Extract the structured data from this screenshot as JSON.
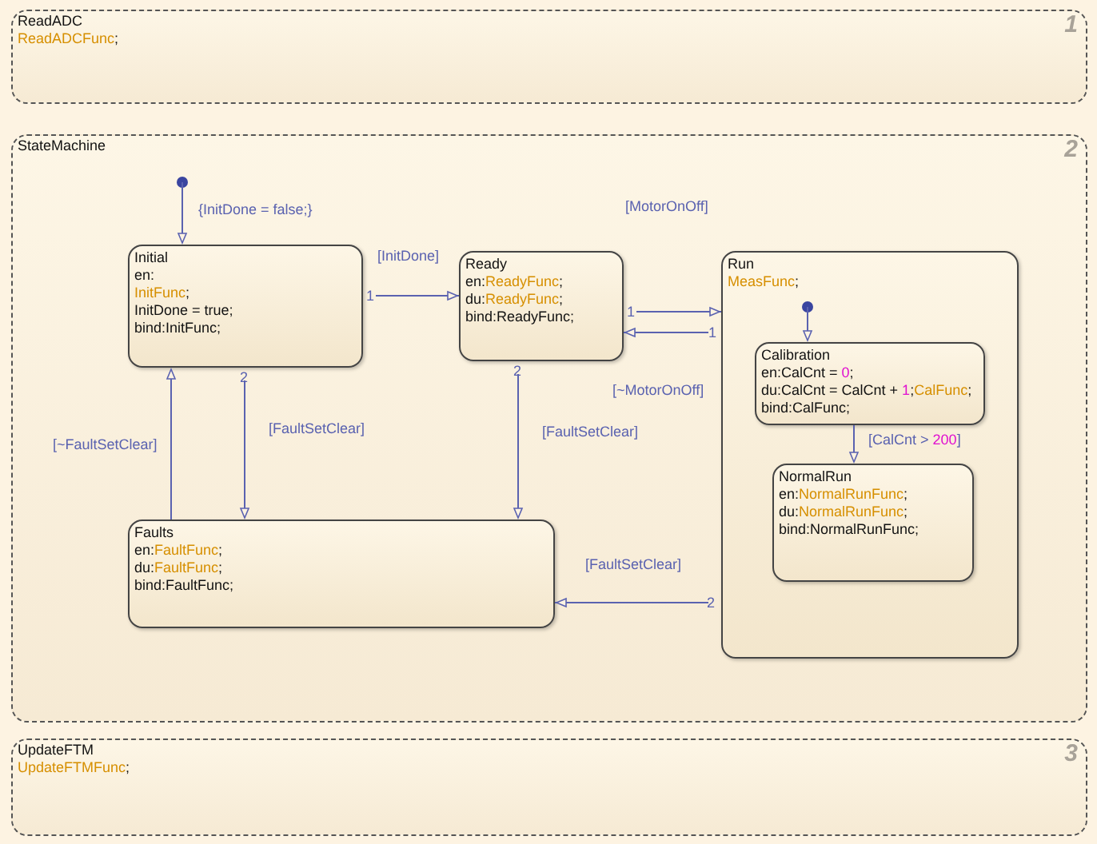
{
  "chart": {
    "parallel_states": [
      {
        "name": "ReadADC",
        "number": "1",
        "lines": [
          [
            {
              "kind": "function",
              "text": "ReadADCFunc"
            },
            {
              "kind": "text",
              "text": ";"
            }
          ]
        ]
      },
      {
        "name": "StateMachine",
        "number": "2",
        "states": [
          {
            "name": "Initial",
            "lines": [
              [
                {
                  "kind": "text",
                  "text": "en:"
                }
              ],
              [
                {
                  "kind": "function",
                  "text": "InitFunc"
                },
                {
                  "kind": "text",
                  "text": ";"
                }
              ],
              [
                {
                  "kind": "text",
                  "text": "InitDone = true;"
                }
              ],
              [
                {
                  "kind": "text",
                  "text": "bind:InitFunc;"
                }
              ]
            ]
          },
          {
            "name": "Ready",
            "lines": [
              [
                {
                  "kind": "text",
                  "text": "en:"
                },
                {
                  "kind": "function",
                  "text": "ReadyFunc"
                },
                {
                  "kind": "text",
                  "text": ";"
                }
              ],
              [
                {
                  "kind": "text",
                  "text": "du:"
                },
                {
                  "kind": "function",
                  "text": "ReadyFunc"
                },
                {
                  "kind": "text",
                  "text": ";"
                }
              ],
              [
                {
                  "kind": "text",
                  "text": "bind:ReadyFunc;"
                }
              ]
            ]
          },
          {
            "name": "Run",
            "lines": [
              [
                {
                  "kind": "function",
                  "text": "MeasFunc"
                },
                {
                  "kind": "text",
                  "text": ";"
                }
              ]
            ],
            "children": [
              {
                "name": "Calibration",
                "lines": [
                  [
                    {
                      "kind": "text",
                      "text": "en:CalCnt = "
                    },
                    {
                      "kind": "number",
                      "text": "0"
                    },
                    {
                      "kind": "text",
                      "text": ";"
                    }
                  ],
                  [
                    {
                      "kind": "text",
                      "text": "du:CalCnt = CalCnt + "
                    },
                    {
                      "kind": "number",
                      "text": "1"
                    },
                    {
                      "kind": "text",
                      "text": ";"
                    },
                    {
                      "kind": "function",
                      "text": "CalFunc"
                    },
                    {
                      "kind": "text",
                      "text": ";"
                    }
                  ],
                  [
                    {
                      "kind": "text",
                      "text": "bind:CalFunc;"
                    }
                  ]
                ]
              },
              {
                "name": "NormalRun",
                "lines": [
                  [
                    {
                      "kind": "text",
                      "text": "en:"
                    },
                    {
                      "kind": "function",
                      "text": "NormalRunFunc"
                    },
                    {
                      "kind": "text",
                      "text": ";"
                    }
                  ],
                  [
                    {
                      "kind": "text",
                      "text": "du:"
                    },
                    {
                      "kind": "function",
                      "text": "NormalRunFunc"
                    },
                    {
                      "kind": "text",
                      "text": ";"
                    }
                  ],
                  [
                    {
                      "kind": "text",
                      "text": "bind:NormalRunFunc;"
                    }
                  ]
                ]
              }
            ],
            "transitions": [
              {
                "kind": "default"
              },
              {
                "kind": "normal",
                "label": [
                  {
                    "kind": "text",
                    "text": "[CalCnt > "
                  },
                  {
                    "kind": "number",
                    "text": "200"
                  },
                  {
                    "kind": "text",
                    "text": "]"
                  }
                ]
              }
            ]
          },
          {
            "name": "Faults",
            "lines": [
              [
                {
                  "kind": "text",
                  "text": "en:"
                },
                {
                  "kind": "function",
                  "text": "FaultFunc"
                },
                {
                  "kind": "text",
                  "text": ";"
                }
              ],
              [
                {
                  "kind": "text",
                  "text": "du:"
                },
                {
                  "kind": "function",
                  "text": "FaultFunc"
                },
                {
                  "kind": "text",
                  "text": ";"
                }
              ],
              [
                {
                  "kind": "text",
                  "text": "bind:FaultFunc;"
                }
              ]
            ]
          }
        ],
        "transitions": [
          {
            "kind": "default",
            "label": [
              {
                "kind": "text",
                "text": "{InitDone = false;}"
              }
            ]
          },
          {
            "kind": "normal",
            "order": "1",
            "label": [
              {
                "kind": "text",
                "text": "[InitDone]"
              }
            ]
          },
          {
            "kind": "normal",
            "order": "1",
            "label": [
              {
                "kind": "text",
                "text": "[MotorOnOff]"
              }
            ]
          },
          {
            "kind": "normal",
            "order": "1",
            "label": [
              {
                "kind": "text",
                "text": "[~MotorOnOff]"
              }
            ]
          },
          {
            "kind": "normal",
            "order": "2",
            "label": [
              {
                "kind": "text",
                "text": "[FaultSetClear]"
              }
            ]
          },
          {
            "kind": "normal",
            "order": "2",
            "label": [
              {
                "kind": "text",
                "text": "[FaultSetClear]"
              }
            ]
          },
          {
            "kind": "normal",
            "label": [
              {
                "kind": "text",
                "text": "[~FaultSetClear]"
              }
            ]
          },
          {
            "kind": "normal",
            "order": "2",
            "label": [
              {
                "kind": "text",
                "text": "[FaultSetClear]"
              }
            ]
          }
        ]
      },
      {
        "name": "UpdateFTM",
        "number": "3",
        "lines": [
          [
            {
              "kind": "function",
              "text": "UpdateFTMFunc"
            },
            {
              "kind": "text",
              "text": ";"
            }
          ]
        ]
      }
    ]
  }
}
